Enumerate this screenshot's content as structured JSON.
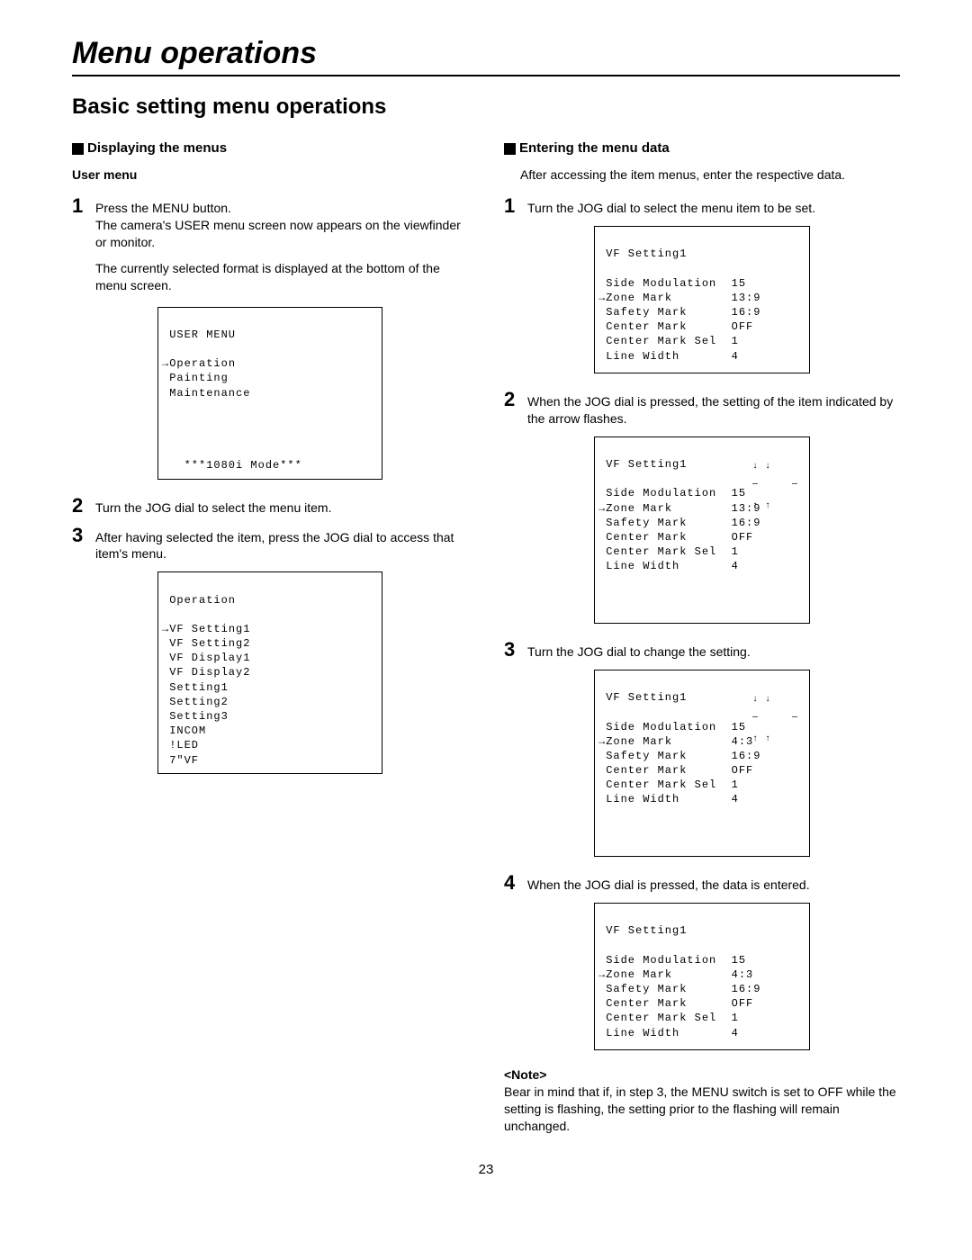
{
  "chapter_title": "Menu operations",
  "section_title": "Basic setting menu operations",
  "left": {
    "sub_heading": "Displaying the menus",
    "user_menu": "User menu",
    "step1a": "Press the MENU button.",
    "step1b": "The camera's USER menu screen now appears on the viewfinder or monitor.",
    "step1c": "The currently selected format is displayed at the bottom of the menu screen.",
    "step2": "Turn the JOG dial to select the menu item.",
    "step3": "After having selected the item, press the JOG dial to access that item's menu.",
    "screen1": {
      "title": " USER MENU",
      "l1": "Operation",
      "l2": " Painting",
      "l3": " Maintenance",
      "foot": "   ***1080i Mode***"
    },
    "screen2": {
      "title": " Operation",
      "l1": "VF Setting1",
      "l2": " VF Setting2",
      "l3": " VF Display1",
      "l4": " VF Display2",
      "l5": " Setting1",
      "l6": " Setting2",
      "l7": " Setting3",
      "l8": " INCOM",
      "l9": " !LED",
      "l10": " 7\"VF"
    }
  },
  "right": {
    "sub_heading": "Entering the menu data",
    "intro": "After accessing the item menus, enter the respective data.",
    "step1": "Turn the JOG dial to select the menu item to be set.",
    "step2": "When the JOG dial is pressed, the setting of the item indicated by the arrow flashes.",
    "step3": "Turn the JOG dial to change the setting.",
    "step4": "When the JOG dial is pressed, the data is entered.",
    "note_head": "<Note>",
    "note_body": "Bear in mind that if, in step 3, the MENU switch is set to OFF while the setting is flashing, the setting prior to the flashing will remain unchanged.",
    "screenA": {
      "title": " VF Setting1",
      "r1a": " Side Modulation",
      "r1b": "15",
      "r2a": "Zone Mark",
      "r2b": "13:9",
      "r3a": " Safety Mark",
      "r3b": "16:9",
      "r4a": " Center Mark",
      "r4b": "OFF",
      "r5a": " Center Mark Sel",
      "r5b": "1",
      "r6a": " Line Width",
      "r6b": "4"
    },
    "screenC": {
      "title": " VF Setting1",
      "r1a": " Side Modulation",
      "r1b": "15",
      "r2a": "Zone Mark",
      "r2b": " 4:3",
      "r3a": " Safety Mark",
      "r3b": "16:9",
      "r4a": " Center Mark",
      "r4b": "OFF",
      "r5a": " Center Mark Sel",
      "r5b": "1",
      "r6a": " Line Width",
      "r6b": "4"
    }
  },
  "page_number": "23"
}
